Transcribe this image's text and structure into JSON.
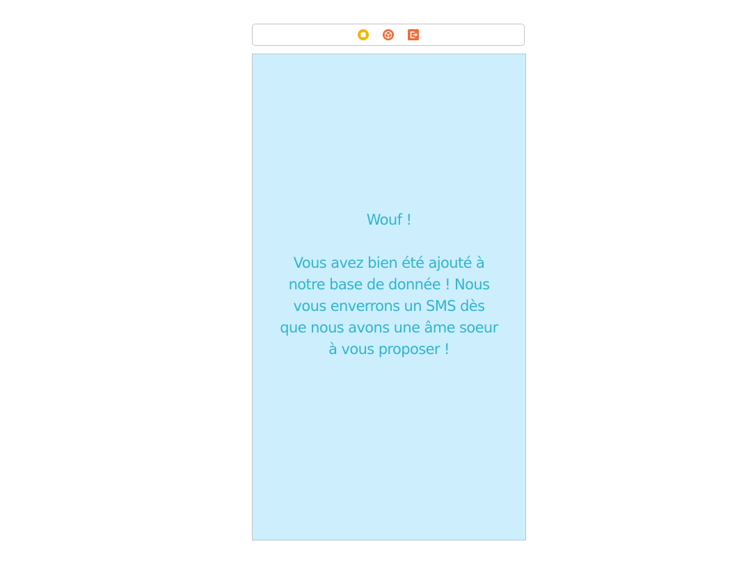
{
  "scene_dock": {
    "icons": [
      {
        "name": "view-controller-icon",
        "color": "#F5B500"
      },
      {
        "name": "first-responder-icon",
        "color": "#EF6C3A"
      },
      {
        "name": "exit-icon",
        "color": "#EF6C3A"
      }
    ]
  },
  "screen": {
    "background": "#CDEEFD",
    "text_color": "#31B5CF",
    "message": "Wouf !\n\nVous avez bien été ajouté à\nnotre base de donnée ! Nous\nvous enverrons un SMS dès\nque nous avons une âme soeur\nà vous proposer !"
  }
}
